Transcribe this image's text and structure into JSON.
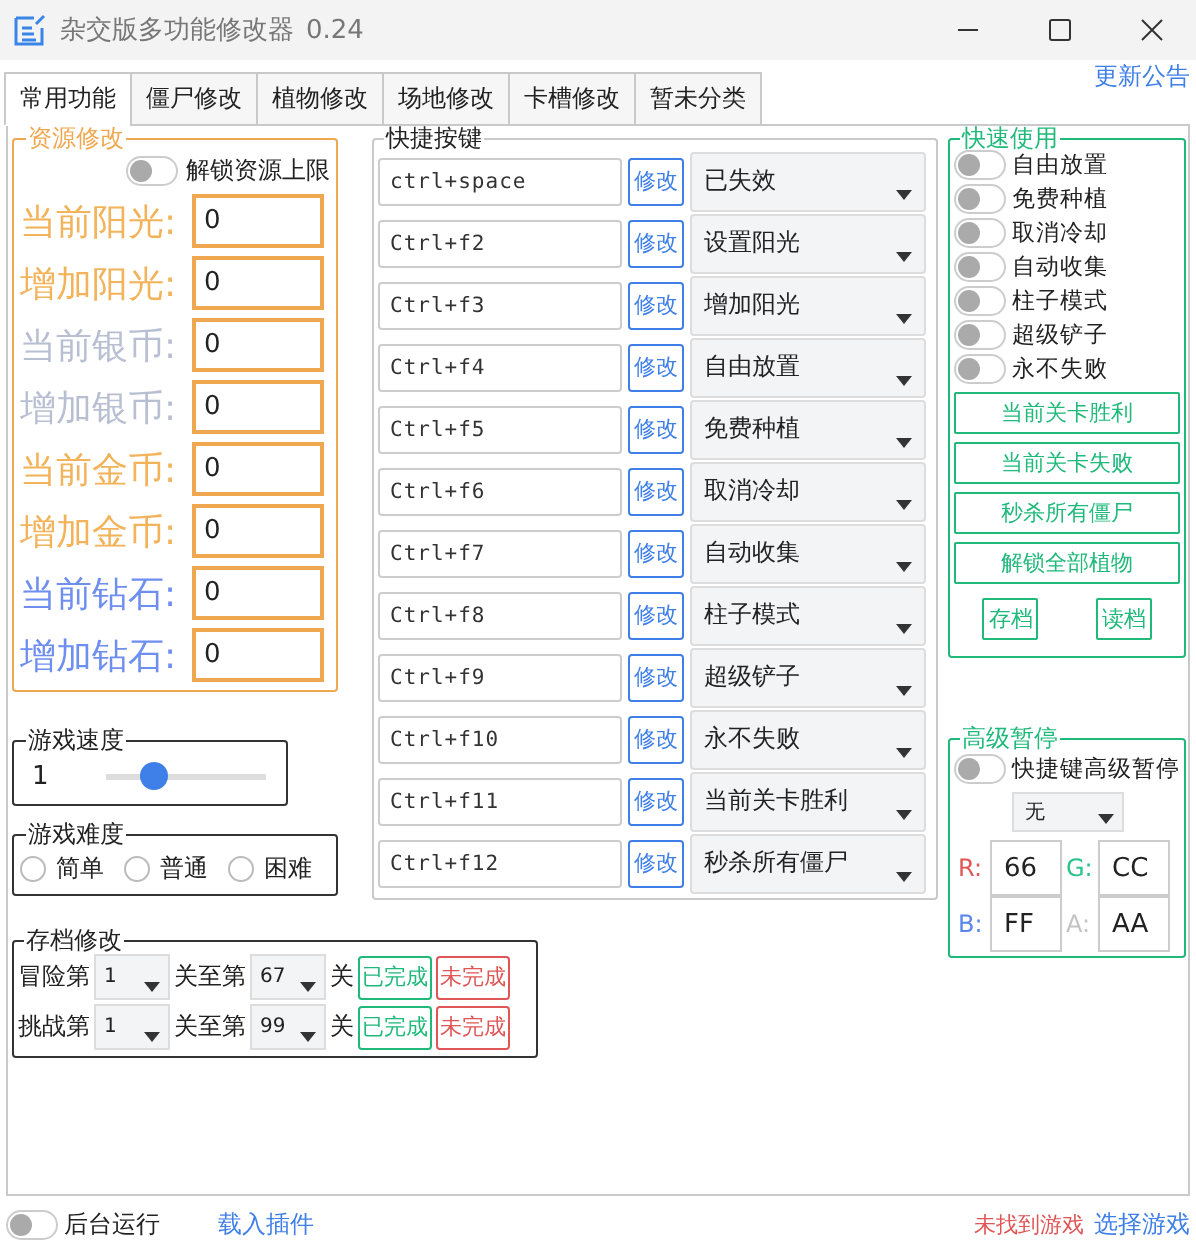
{
  "window": {
    "title": "杂交版多功能修改器",
    "version": "0.24"
  },
  "tabs": [
    {
      "label": "常用功能",
      "selected": true
    },
    {
      "label": "僵尸修改",
      "selected": false
    },
    {
      "label": "植物修改",
      "selected": false
    },
    {
      "label": "场地修改",
      "selected": false
    },
    {
      "label": "卡槽修改",
      "selected": false
    },
    {
      "label": "暂未分类",
      "selected": false
    }
  ],
  "update_link": "更新公告",
  "resources": {
    "title": "资源修改",
    "unlock": {
      "label": "解锁资源上限",
      "on": false
    },
    "fields": [
      {
        "label": "当前阳光:",
        "value": "0",
        "color": "#f2b35a"
      },
      {
        "label": "增加阳光:",
        "value": "0",
        "color": "#f2b35a"
      },
      {
        "label": "当前银币:",
        "value": "0",
        "color": "#b8bfd2"
      },
      {
        "label": "增加银币:",
        "value": "0",
        "color": "#b8bfd2"
      },
      {
        "label": "当前金币:",
        "value": "0",
        "color": "#f2b35a"
      },
      {
        "label": "增加金币:",
        "value": "0",
        "color": "#f2b35a"
      },
      {
        "label": "当前钻石:",
        "value": "0",
        "color": "#6f8ff0"
      },
      {
        "label": "增加钻石:",
        "value": "0",
        "color": "#6f8ff0"
      }
    ]
  },
  "speed": {
    "title": "游戏速度",
    "value": "1",
    "level": 0.3
  },
  "difficulty": {
    "title": "游戏难度",
    "options": [
      {
        "label": "简单",
        "selected": false
      },
      {
        "label": "普通",
        "selected": false
      },
      {
        "label": "困难",
        "selected": false
      }
    ]
  },
  "save": {
    "title": "存档修改",
    "rows": [
      {
        "prefix": "冒险第",
        "from": "1",
        "middle": "关至第",
        "to": "67",
        "suffix": "关",
        "done": "已完成",
        "undone": "未完成"
      },
      {
        "prefix": "挑战第",
        "from": "1",
        "middle": "关至第",
        "to": "99",
        "suffix": "关",
        "done": "已完成",
        "undone": "未完成"
      }
    ]
  },
  "hotkeys": {
    "title": "快捷按键",
    "rows": [
      {
        "key": "ctrl+space",
        "button": "修改",
        "action": "已失效"
      },
      {
        "key": "Ctrl+f2",
        "button": "修改",
        "action": "设置阳光"
      },
      {
        "key": "Ctrl+f3",
        "button": "修改",
        "action": "增加阳光"
      },
      {
        "key": "Ctrl+f4",
        "button": "修改",
        "action": "自由放置"
      },
      {
        "key": "Ctrl+f5",
        "button": "修改",
        "action": "免费种植"
      },
      {
        "key": "Ctrl+f6",
        "button": "修改",
        "action": "取消冷却"
      },
      {
        "key": "Ctrl+f7",
        "button": "修改",
        "action": "自动收集"
      },
      {
        "key": "Ctrl+f8",
        "button": "修改",
        "action": "柱子模式"
      },
      {
        "key": "Ctrl+f9",
        "button": "修改",
        "action": "超级铲子"
      },
      {
        "key": "Ctrl+f10",
        "button": "修改",
        "action": "永不失败"
      },
      {
        "key": "Ctrl+f11",
        "button": "修改",
        "action": "当前关卡胜利"
      },
      {
        "key": "Ctrl+f12",
        "button": "修改",
        "action": "秒杀所有僵尸"
      }
    ]
  },
  "quick": {
    "title": "快速使用",
    "toggles": [
      {
        "label": "自由放置",
        "on": false
      },
      {
        "label": "免费种植",
        "on": false
      },
      {
        "label": "取消冷却",
        "on": false
      },
      {
        "label": "自动收集",
        "on": false
      },
      {
        "label": "柱子模式",
        "on": false
      },
      {
        "label": "超级铲子",
        "on": false
      },
      {
        "label": "永不失败",
        "on": false
      }
    ],
    "buttons": [
      "当前关卡胜利",
      "当前关卡失败",
      "秒杀所有僵尸",
      "解锁全部植物"
    ],
    "small_buttons": [
      "存档",
      "读档"
    ]
  },
  "pause": {
    "title": "高级暂停",
    "toggle": {
      "label": "快捷键高级暂停",
      "on": false
    },
    "select": "无",
    "colors": [
      {
        "label": "R:",
        "value": "66",
        "color": "#e05555"
      },
      {
        "label": "G:",
        "value": "CC",
        "color": "#2cc38a"
      },
      {
        "label": "B:",
        "value": "FF",
        "color": "#5a86ee"
      },
      {
        "label": "A:",
        "value": "AA",
        "color": "#c4c4c4"
      }
    ]
  },
  "footer": {
    "background": {
      "label": "后台运行",
      "on": false
    },
    "plugin": "载入插件",
    "status": "未找到游戏",
    "select_game": "选择游戏"
  }
}
